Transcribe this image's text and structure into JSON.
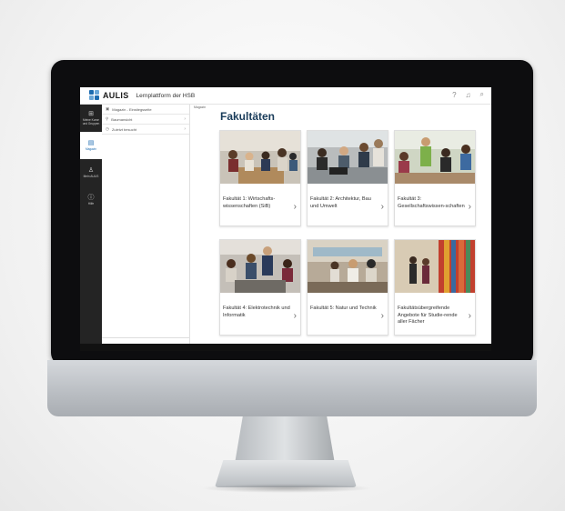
{
  "app": {
    "logo_text": "AULIS",
    "title": "Lernplattform der HSB"
  },
  "topbar_icons": [
    "help-icon",
    "bell-icon",
    "search-icon"
  ],
  "rail": [
    {
      "icon": "grid-icon",
      "label": "Meine Kurse und Gruppen"
    },
    {
      "icon": "magazine-icon",
      "label": "Magazin",
      "active": true
    },
    {
      "icon": "person-icon",
      "label": "Mein AULIS"
    },
    {
      "icon": "help-icon",
      "label": "Hilfe"
    }
  ],
  "sidebar": [
    {
      "icon": "home-icon",
      "label": "Magazin - Einstiegsseite"
    },
    {
      "icon": "tree-icon",
      "label": "Baumansicht"
    },
    {
      "icon": "clock-icon",
      "label": "Zuletzt besucht"
    }
  ],
  "breadcrumb": "Magazin",
  "page_title": "Fakultäten",
  "cards": [
    {
      "label": "Fakultät 1: Wirtschafts-wissenschaften (SiB)"
    },
    {
      "label": "Fakultät 2: Architektur, Bau und Umwelt"
    },
    {
      "label": "Fakultät 3: Gesellschaftswissen-schaften"
    },
    {
      "label": "Fakultät 4: Elektrotechnik und Informatik"
    },
    {
      "label": "Fakultät 5: Natur und Technik"
    },
    {
      "label": "Fakultätsübergreifende Angebote für Studie-rende aller Fächer"
    }
  ],
  "colors": {
    "accent": "#1c6bb0",
    "title": "#1a3c5a",
    "rail": "#242424",
    "notification": "#f0a020"
  }
}
